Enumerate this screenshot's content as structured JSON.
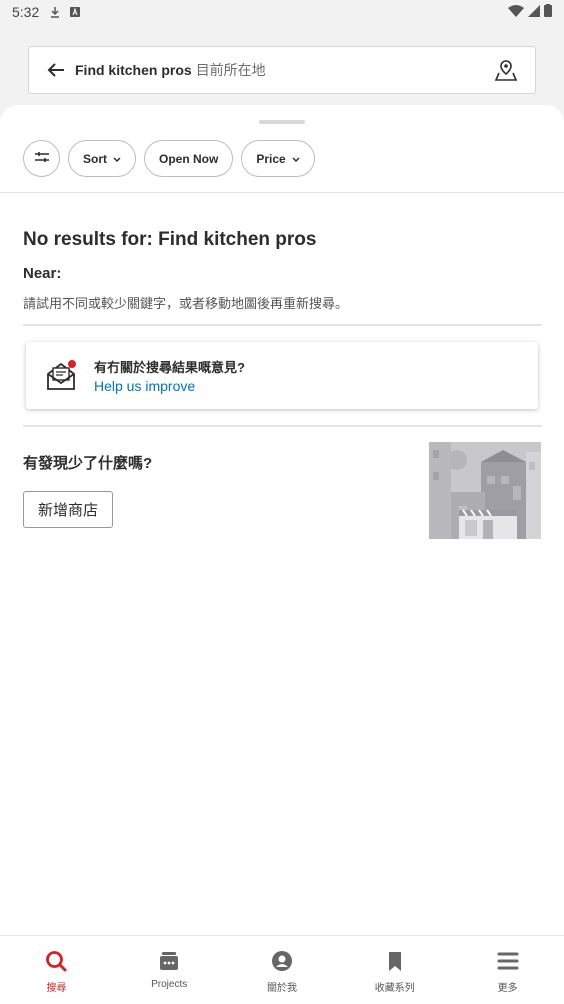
{
  "status_bar": {
    "time": "5:32"
  },
  "search": {
    "query": "Find kitchen pros",
    "location_placeholder": "目前所在地"
  },
  "filters": [
    {
      "label": "Sort",
      "has_dropdown": true
    },
    {
      "label": "Open Now",
      "has_dropdown": false
    },
    {
      "label": "Price",
      "has_dropdown": true
    }
  ],
  "results": {
    "no_results": "No results for: Find kitchen pros",
    "near_label": "Near:",
    "hint": "請試用不同或較少關鍵字，或者移動地圖後再重新搜尋。"
  },
  "feedback": {
    "question": "有冇關於搜尋結果嘅意見?",
    "link": "Help us improve"
  },
  "missing": {
    "title": "有發現少了什麼嗎?",
    "add_button": "新增商店"
  },
  "bottom_nav": [
    {
      "label": "搜尋",
      "icon": "search-icon",
      "active": true
    },
    {
      "label": "Projects",
      "icon": "projects-icon",
      "active": false
    },
    {
      "label": "關於我",
      "icon": "profile-icon",
      "active": false
    },
    {
      "label": "收藏系列",
      "icon": "bookmark-icon",
      "active": false
    },
    {
      "label": "更多",
      "icon": "menu-icon",
      "active": false
    }
  ],
  "colors": {
    "accent": "#d32323",
    "link": "#0073bb",
    "text": "#2d2d2d"
  }
}
